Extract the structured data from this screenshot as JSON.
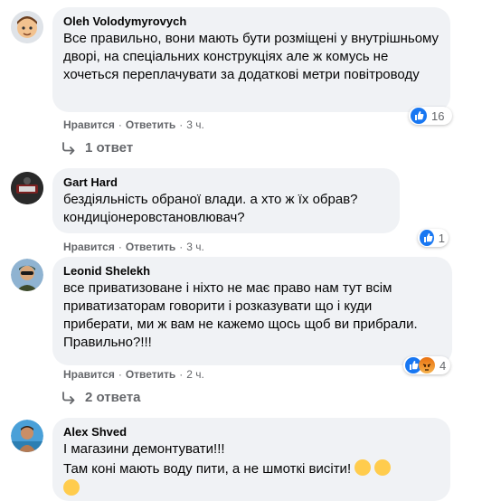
{
  "comments": [
    {
      "author": "Oleh Volodymyrovych",
      "text": "Все правильно, вони мають бути розміщені у внутрішньому дворі, на спеціальних конструкціях але ж комусь не хочеться переплачувати за додаткові метри повітроводу",
      "like_label": "Нравится",
      "reply_label": "Ответить",
      "time": "3 ч.",
      "reaction_count": "16",
      "replies_label": "1 ответ"
    },
    {
      "author": "Gart Hard",
      "text": "бездіяльність обраної влади. а хто ж їх обрав? кондиціонеровстановлювач?",
      "like_label": "Нравится",
      "reply_label": "Ответить",
      "time": "3 ч.",
      "reaction_count": "1"
    },
    {
      "author": "Leonid Shelekh",
      "text": "все приватизоване і ніхто не має право нам тут всім приватизаторам говорити і розказувати що і куди приберати, ми ж вам не кажемо щось щоб ви прибрали. Правильно?!!!",
      "like_label": "Нравится",
      "reply_label": "Ответить",
      "time": "2 ч.",
      "reaction_count": "4",
      "replies_label": "2 ответа"
    },
    {
      "author": "Alex Shved",
      "text_line1": "І магазини демонтувати!!!",
      "text_line2": "Там коні мають воду пити, а не шмоткі висіти!"
    }
  ]
}
